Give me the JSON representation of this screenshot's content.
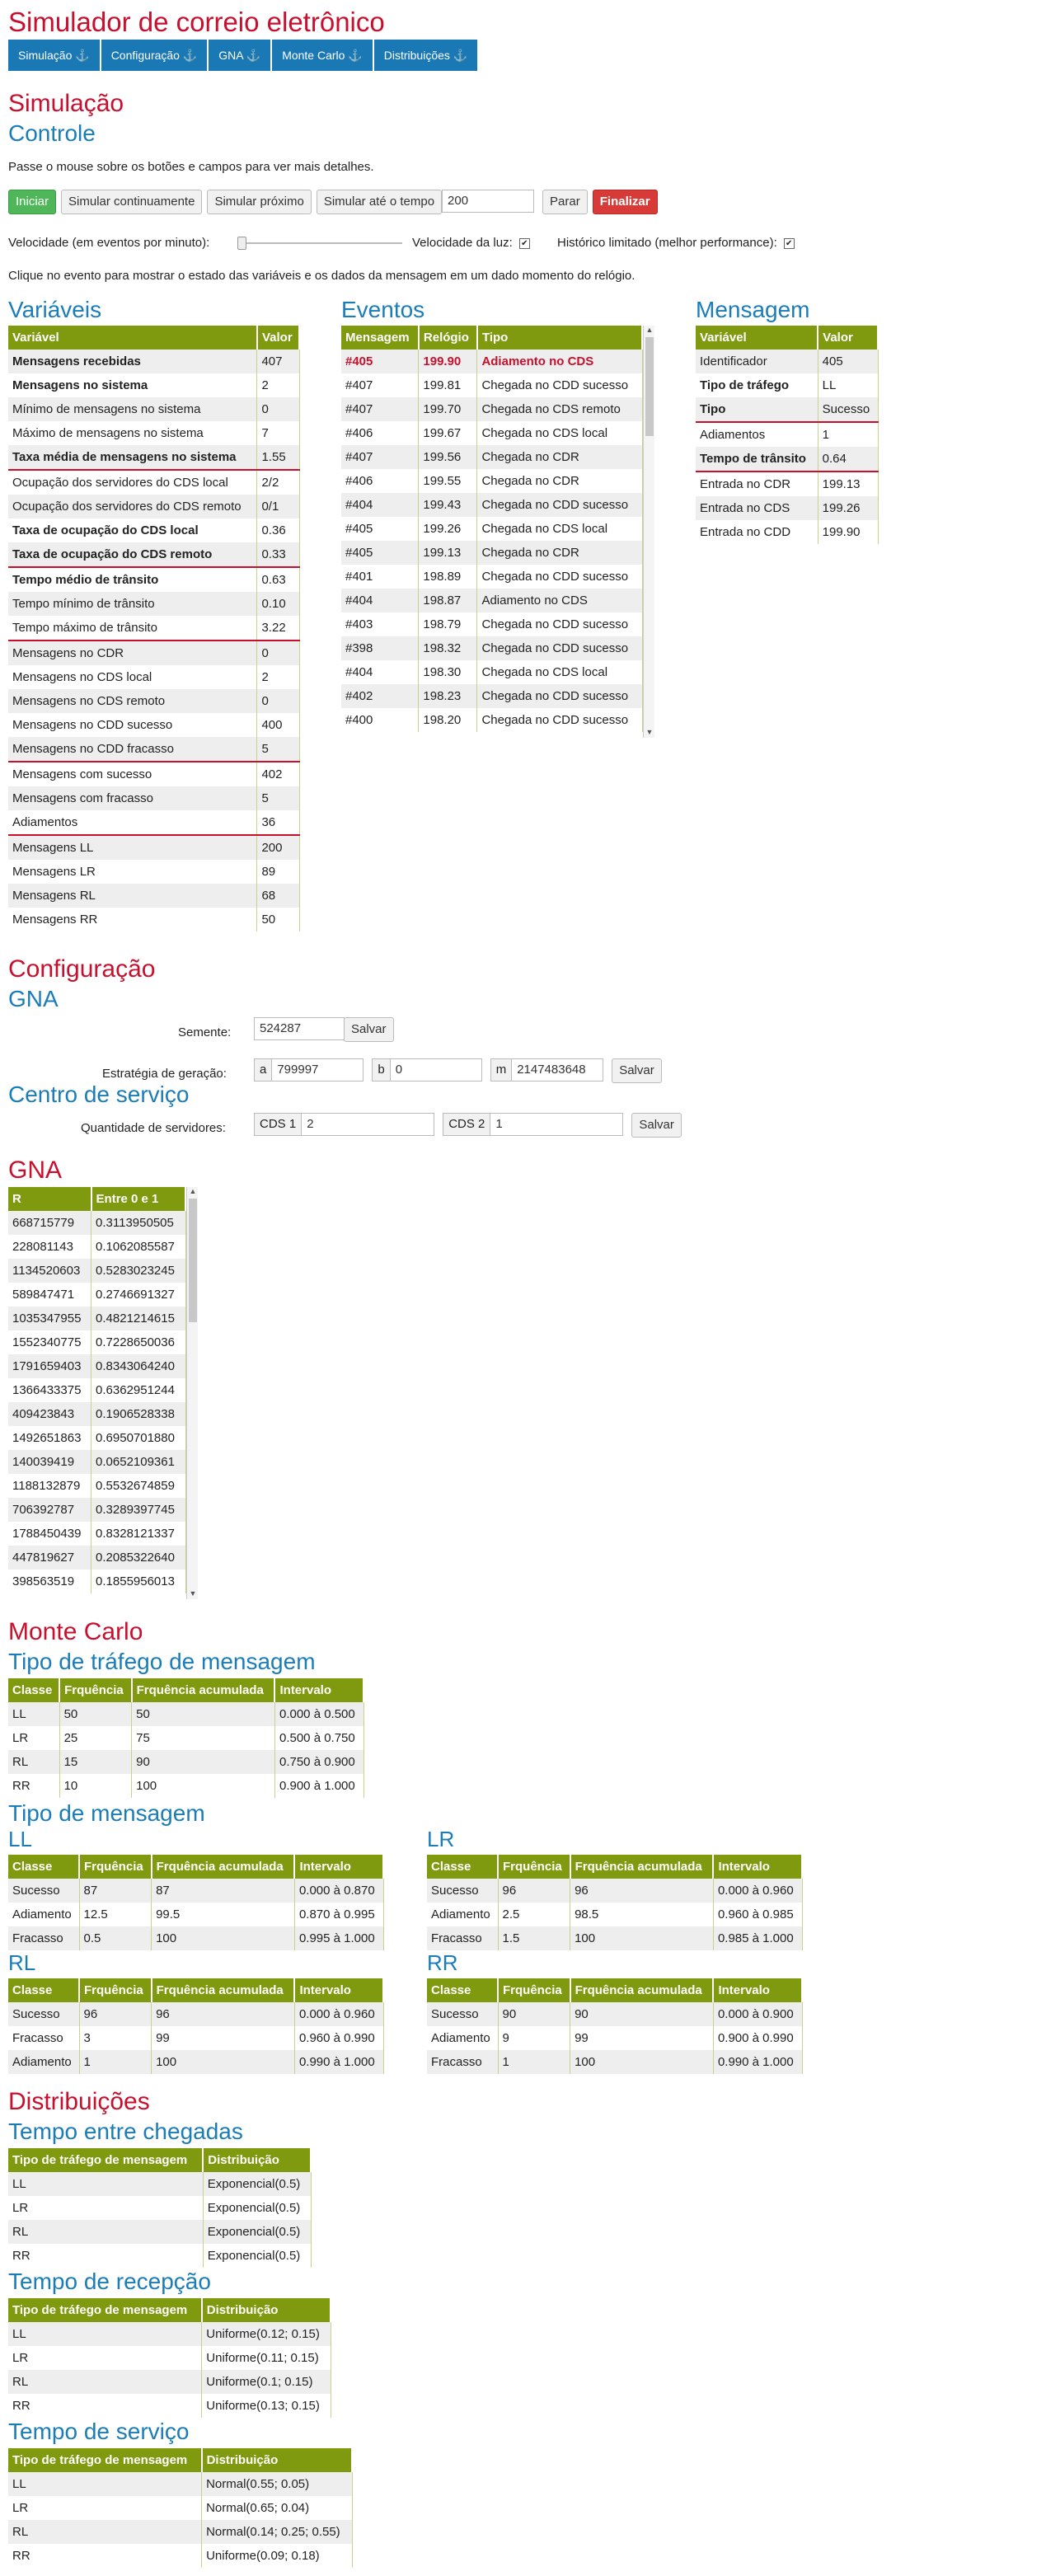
{
  "title": "Simulador de correio eletrônico",
  "nav": [
    "Simulação ⚓",
    "Configuração ⚓",
    "GNA ⚓",
    "Monte Carlo ⚓",
    "Distribuições ⚓"
  ],
  "sim": {
    "title": "Simulação",
    "controle": "Controle",
    "hint": "Passe o mouse sobre os botões e campos para ver mais detalhes.",
    "buttons": {
      "iniciar": "Iniciar",
      "continuo": "Simular continuamente",
      "proximo": "Simular próximo",
      "ate": "Simular até o tempo",
      "ate_value": "200",
      "parar": "Parar",
      "finalizar": "Finalizar"
    },
    "speed_label": "Velocidade (em eventos por minuto):",
    "light_label": "Velocidade da luz:",
    "hist_label": "Histórico limitado (melhor performance):",
    "click_hint": "Clique no evento para mostrar o estado das variáveis e os dados da mensagem em um dado momento do relógio."
  },
  "variaveis": {
    "title": "Variáveis",
    "headers": [
      "Variável",
      "Valor"
    ],
    "rows": [
      [
        "Mensagens recebidas",
        "407",
        1,
        0
      ],
      [
        "Mensagens no sistema",
        "2",
        1,
        0
      ],
      [
        "Mínimo de mensagens no sistema",
        "0",
        0,
        0
      ],
      [
        "Máximo de mensagens no sistema",
        "7",
        0,
        0
      ],
      [
        "Taxa média de mensagens no sistema",
        "1.55",
        1,
        1
      ],
      [
        "Ocupação dos servidores do CDS local",
        "2/2",
        0,
        0
      ],
      [
        "Ocupação dos servidores do CDS remoto",
        "0/1",
        0,
        0
      ],
      [
        "Taxa de ocupação do CDS local",
        "0.36",
        1,
        0
      ],
      [
        "Taxa de ocupação do CDS remoto",
        "0.33",
        1,
        1
      ],
      [
        "Tempo médio de trânsito",
        "0.63",
        1,
        0
      ],
      [
        "Tempo mínimo de trânsito",
        "0.10",
        0,
        0
      ],
      [
        "Tempo máximo de trânsito",
        "3.22",
        0,
        1
      ],
      [
        "Mensagens no CDR",
        "0",
        0,
        0
      ],
      [
        "Mensagens no CDS local",
        "2",
        0,
        0
      ],
      [
        "Mensagens no CDS remoto",
        "0",
        0,
        0
      ],
      [
        "Mensagens no CDD sucesso",
        "400",
        0,
        0
      ],
      [
        "Mensagens no CDD fracasso",
        "5",
        0,
        1
      ],
      [
        "Mensagens com sucesso",
        "402",
        0,
        0
      ],
      [
        "Mensagens com fracasso",
        "5",
        0,
        0
      ],
      [
        "Adiamentos",
        "36",
        0,
        1
      ],
      [
        "Mensagens LL",
        "200",
        0,
        0
      ],
      [
        "Mensagens LR",
        "89",
        0,
        0
      ],
      [
        "Mensagens RL",
        "68",
        0,
        0
      ],
      [
        "Mensagens RR",
        "50",
        0,
        0
      ]
    ]
  },
  "eventos": {
    "title": "Eventos",
    "headers": [
      "Mensagem",
      "Relógio",
      "Tipo"
    ],
    "rows": [
      [
        "#405",
        "199.90",
        "Adiamento no CDS"
      ],
      [
        "#407",
        "199.81",
        "Chegada no CDD sucesso"
      ],
      [
        "#407",
        "199.70",
        "Chegada no CDS remoto"
      ],
      [
        "#406",
        "199.67",
        "Chegada no CDS local"
      ],
      [
        "#407",
        "199.56",
        "Chegada no CDR"
      ],
      [
        "#406",
        "199.55",
        "Chegada no CDR"
      ],
      [
        "#404",
        "199.43",
        "Chegada no CDD sucesso"
      ],
      [
        "#405",
        "199.26",
        "Chegada no CDS local"
      ],
      [
        "#405",
        "199.13",
        "Chegada no CDR"
      ],
      [
        "#401",
        "198.89",
        "Chegada no CDD sucesso"
      ],
      [
        "#404",
        "198.87",
        "Adiamento no CDS"
      ],
      [
        "#403",
        "198.79",
        "Chegada no CDD sucesso"
      ],
      [
        "#398",
        "198.32",
        "Chegada no CDD sucesso"
      ],
      [
        "#404",
        "198.30",
        "Chegada no CDS local"
      ],
      [
        "#402",
        "198.23",
        "Chegada no CDD sucesso"
      ],
      [
        "#400",
        "198.20",
        "Chegada no CDD sucesso"
      ]
    ]
  },
  "mensagem": {
    "title": "Mensagem",
    "headers": [
      "Variável",
      "Valor"
    ],
    "rows": [
      [
        "Identificador",
        "405",
        0,
        0
      ],
      [
        "Tipo de tráfego",
        "LL",
        1,
        0
      ],
      [
        "Tipo",
        "Sucesso",
        1,
        1
      ],
      [
        "Adiamentos",
        "1",
        0,
        0
      ],
      [
        "Tempo de trânsito",
        "0.64",
        1,
        1
      ],
      [
        "Entrada no CDR",
        "199.13",
        0,
        0
      ],
      [
        "Entrada no CDS",
        "199.26",
        0,
        0
      ],
      [
        "Entrada no CDD",
        "199.90",
        0,
        0
      ]
    ]
  },
  "config": {
    "title": "Configuração",
    "gna": "GNA",
    "semente_label": "Semente:",
    "semente": "524287",
    "salvar": "Salvar",
    "estrategia_label": "Estratégia de geração:",
    "a": "799997",
    "b": "0",
    "m": "2147483648",
    "a_l": "a",
    "b_l": "b",
    "m_l": "m",
    "centro": "Centro de serviço",
    "qtd_label": "Quantidade de servidores:",
    "cds1_l": "CDS 1",
    "cds1": "2",
    "cds2_l": "CDS 2",
    "cds2": "1"
  },
  "gna": {
    "title": "GNA",
    "headers": [
      "R",
      "Entre 0 e 1"
    ],
    "rows": [
      [
        "668715779",
        "0.3113950505"
      ],
      [
        "228081143",
        "0.1062085587"
      ],
      [
        "1134520603",
        "0.5283023245"
      ],
      [
        "589847471",
        "0.2746691327"
      ],
      [
        "1035347955",
        "0.4821214615"
      ],
      [
        "1552340775",
        "0.7228650036"
      ],
      [
        "1791659403",
        "0.8343064240"
      ],
      [
        "1366433375",
        "0.6362951244"
      ],
      [
        "409423843",
        "0.1906528338"
      ],
      [
        "1492651863",
        "0.6950701880"
      ],
      [
        "140039419",
        "0.0652109361"
      ],
      [
        "1188132879",
        "0.5532674859"
      ],
      [
        "706392787",
        "0.3289397745"
      ],
      [
        "1788450439",
        "0.8328121337"
      ],
      [
        "447819627",
        "0.2085322640"
      ],
      [
        "398563519",
        "0.1855956013"
      ]
    ]
  },
  "mc": {
    "title": "Monte Carlo",
    "trafego": "Tipo de tráfego de mensagem",
    "headers": [
      "Classe",
      "Frquência",
      "Frquência acumulada",
      "Intervalo"
    ],
    "trafego_rows": [
      [
        "LL",
        "50",
        "50",
        "0.000 à 0.500"
      ],
      [
        "LR",
        "25",
        "75",
        "0.500 à 0.750"
      ],
      [
        "RL",
        "15",
        "90",
        "0.750 à 0.900"
      ],
      [
        "RR",
        "10",
        "100",
        "0.900 à 1.000"
      ]
    ],
    "tipo": "Tipo de mensagem",
    "LL": {
      "t": "LL",
      "rows": [
        [
          "Sucesso",
          "87",
          "87",
          "0.000 à 0.870"
        ],
        [
          "Adiamento",
          "12.5",
          "99.5",
          "0.870 à 0.995"
        ],
        [
          "Fracasso",
          "0.5",
          "100",
          "0.995 à 1.000"
        ]
      ]
    },
    "LR": {
      "t": "LR",
      "rows": [
        [
          "Sucesso",
          "96",
          "96",
          "0.000 à 0.960"
        ],
        [
          "Adiamento",
          "2.5",
          "98.5",
          "0.960 à 0.985"
        ],
        [
          "Fracasso",
          "1.5",
          "100",
          "0.985 à 1.000"
        ]
      ]
    },
    "RL": {
      "t": "RL",
      "rows": [
        [
          "Sucesso",
          "96",
          "96",
          "0.000 à 0.960"
        ],
        [
          "Fracasso",
          "3",
          "99",
          "0.960 à 0.990"
        ],
        [
          "Adiamento",
          "1",
          "100",
          "0.990 à 1.000"
        ]
      ]
    },
    "RR": {
      "t": "RR",
      "rows": [
        [
          "Sucesso",
          "90",
          "90",
          "0.000 à 0.900"
        ],
        [
          "Adiamento",
          "9",
          "99",
          "0.900 à 0.990"
        ],
        [
          "Fracasso",
          "1",
          "100",
          "0.990 à 1.000"
        ]
      ]
    }
  },
  "dist": {
    "title": "Distribuições",
    "headers": [
      "Tipo de tráfego de mensagem",
      "Distribuição"
    ],
    "chegadas": {
      "t": "Tempo entre chegadas",
      "rows": [
        [
          "LL",
          "Exponencial(0.5)"
        ],
        [
          "LR",
          "Exponencial(0.5)"
        ],
        [
          "RL",
          "Exponencial(0.5)"
        ],
        [
          "RR",
          "Exponencial(0.5)"
        ]
      ]
    },
    "recepcao": {
      "t": "Tempo de recepção",
      "rows": [
        [
          "LL",
          "Uniforme(0.12; 0.15)"
        ],
        [
          "LR",
          "Uniforme(0.11; 0.15)"
        ],
        [
          "RL",
          "Uniforme(0.1; 0.15)"
        ],
        [
          "RR",
          "Uniforme(0.13; 0.15)"
        ]
      ]
    },
    "servico": {
      "t": "Tempo de serviço",
      "rows": [
        [
          "LL",
          "Normal(0.55; 0.05)"
        ],
        [
          "LR",
          "Normal(0.65; 0.04)"
        ],
        [
          "RL",
          "Normal(0.14; 0.25; 0.55)"
        ],
        [
          "RR",
          "Uniforme(0.09; 0.18)"
        ]
      ]
    }
  }
}
